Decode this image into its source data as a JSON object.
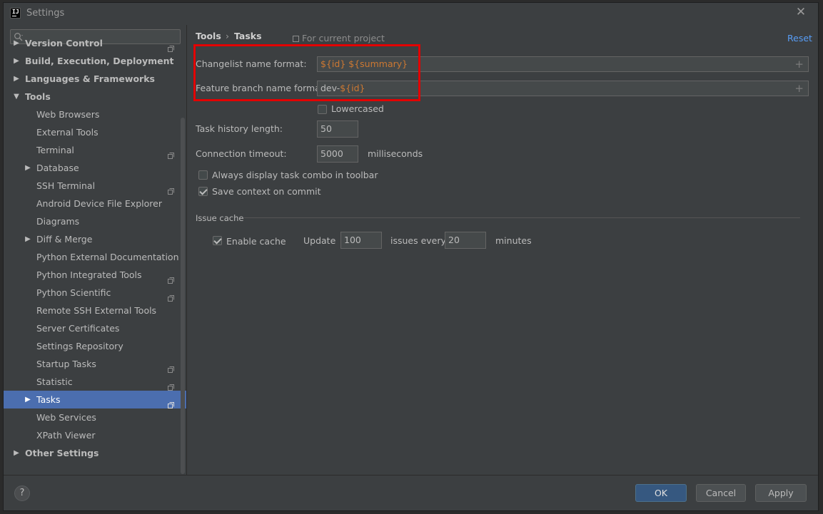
{
  "window": {
    "title": "Settings",
    "app_icon_text": "IJ"
  },
  "search": {
    "value": "",
    "placeholder": ""
  },
  "sidebar": {
    "items": [
      {
        "label": "Version Control",
        "bold": true,
        "arrow": "▶",
        "project": true
      },
      {
        "label": "Build, Execution, Deployment",
        "bold": true,
        "arrow": "▶",
        "project": false
      },
      {
        "label": "Languages & Frameworks",
        "bold": true,
        "arrow": "▶",
        "project": false
      },
      {
        "label": "Tools",
        "bold": true,
        "arrow": "▼",
        "project": false
      },
      {
        "label": "Web Browsers",
        "bold": false,
        "arrow": "",
        "project": false
      },
      {
        "label": "External Tools",
        "bold": false,
        "arrow": "",
        "project": false
      },
      {
        "label": "Terminal",
        "bold": false,
        "arrow": "",
        "project": true
      },
      {
        "label": "Database",
        "bold": false,
        "arrow": "▶",
        "project": false
      },
      {
        "label": "SSH Terminal",
        "bold": false,
        "arrow": "",
        "project": true
      },
      {
        "label": "Android Device File Explorer",
        "bold": false,
        "arrow": "",
        "project": false
      },
      {
        "label": "Diagrams",
        "bold": false,
        "arrow": "",
        "project": false
      },
      {
        "label": "Diff & Merge",
        "bold": false,
        "arrow": "▶",
        "project": false
      },
      {
        "label": "Python External Documentation",
        "bold": false,
        "arrow": "",
        "project": false
      },
      {
        "label": "Python Integrated Tools",
        "bold": false,
        "arrow": "",
        "project": true
      },
      {
        "label": "Python Scientific",
        "bold": false,
        "arrow": "",
        "project": true
      },
      {
        "label": "Remote SSH External Tools",
        "bold": false,
        "arrow": "",
        "project": false
      },
      {
        "label": "Server Certificates",
        "bold": false,
        "arrow": "",
        "project": false
      },
      {
        "label": "Settings Repository",
        "bold": false,
        "arrow": "",
        "project": false
      },
      {
        "label": "Startup Tasks",
        "bold": false,
        "arrow": "",
        "project": true
      },
      {
        "label": "Statistic",
        "bold": false,
        "arrow": "",
        "project": true
      },
      {
        "label": "Tasks",
        "bold": false,
        "arrow": "▶",
        "project": true,
        "selected": true
      },
      {
        "label": "Web Services",
        "bold": false,
        "arrow": "",
        "project": false
      },
      {
        "label": "XPath Viewer",
        "bold": false,
        "arrow": "",
        "project": false
      },
      {
        "label": "Other Settings",
        "bold": true,
        "arrow": "▶",
        "project": false
      }
    ]
  },
  "breadcrumb": {
    "root": "Tools",
    "separator": "›",
    "current": "Tasks"
  },
  "scope_label": "For current project",
  "reset_label": "Reset",
  "form": {
    "changelist_label": "Changelist name format:",
    "changelist_parts": [
      "${id}",
      " ",
      "${summary}"
    ],
    "feature_label": "Feature branch name format:",
    "feature_parts": [
      "dev-",
      "${id}"
    ],
    "lowercased_label": "Lowercased",
    "lowercased_checked": false,
    "history_label": "Task history length:",
    "history_value": "50",
    "timeout_label": "Connection timeout:",
    "timeout_value": "5000",
    "timeout_unit": "milliseconds",
    "always_display_label": "Always display task combo in toolbar",
    "always_display_checked": false,
    "save_context_label": "Save context on commit",
    "save_context_checked": true
  },
  "issue_cache": {
    "title": "Issue cache",
    "enable_label": "Enable cache",
    "enable_checked": true,
    "update_label": "Update",
    "update_value": "100",
    "issues_every_label": "issues every",
    "minutes_value": "20",
    "minutes_label": "minutes"
  },
  "footer": {
    "help": "?",
    "ok": "OK",
    "cancel": "Cancel",
    "apply": "Apply"
  },
  "colors": {
    "background": "#3c3f41",
    "selection": "#4b6eaf",
    "link": "#589df6",
    "highlight_box": "#e30000",
    "primary_button": "#365880"
  }
}
